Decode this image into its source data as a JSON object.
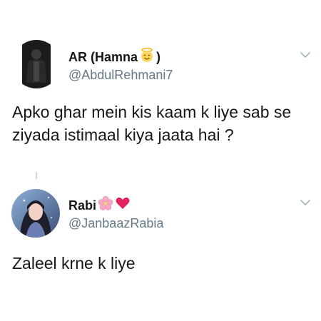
{
  "tweets": [
    {
      "display_name": "AR (Hamna",
      "display_name_suffix": ")",
      "name_emoji": "smiling-face-with-halo-emoji",
      "handle": "@AbdulRehmani7",
      "text": "Apko ghar mein kis kaam k liye sab se ziyada istimaal kiya jaata hai ?",
      "menu_icon": "chevron-down-icon"
    },
    {
      "display_name": "Rabi",
      "name_emojis": [
        "cherry-blossom-emoji",
        "red-heart-emoji"
      ],
      "handle": "@JanbaazRabia",
      "text": "Zaleel krne k liye",
      "menu_icon": "chevron-down-icon"
    }
  ],
  "colors": {
    "primary_text": "#14171a",
    "secondary_text": "#657786",
    "chevron": "#aab8c2",
    "heart": "#e0245e",
    "blossom": "#f7a8c4"
  }
}
